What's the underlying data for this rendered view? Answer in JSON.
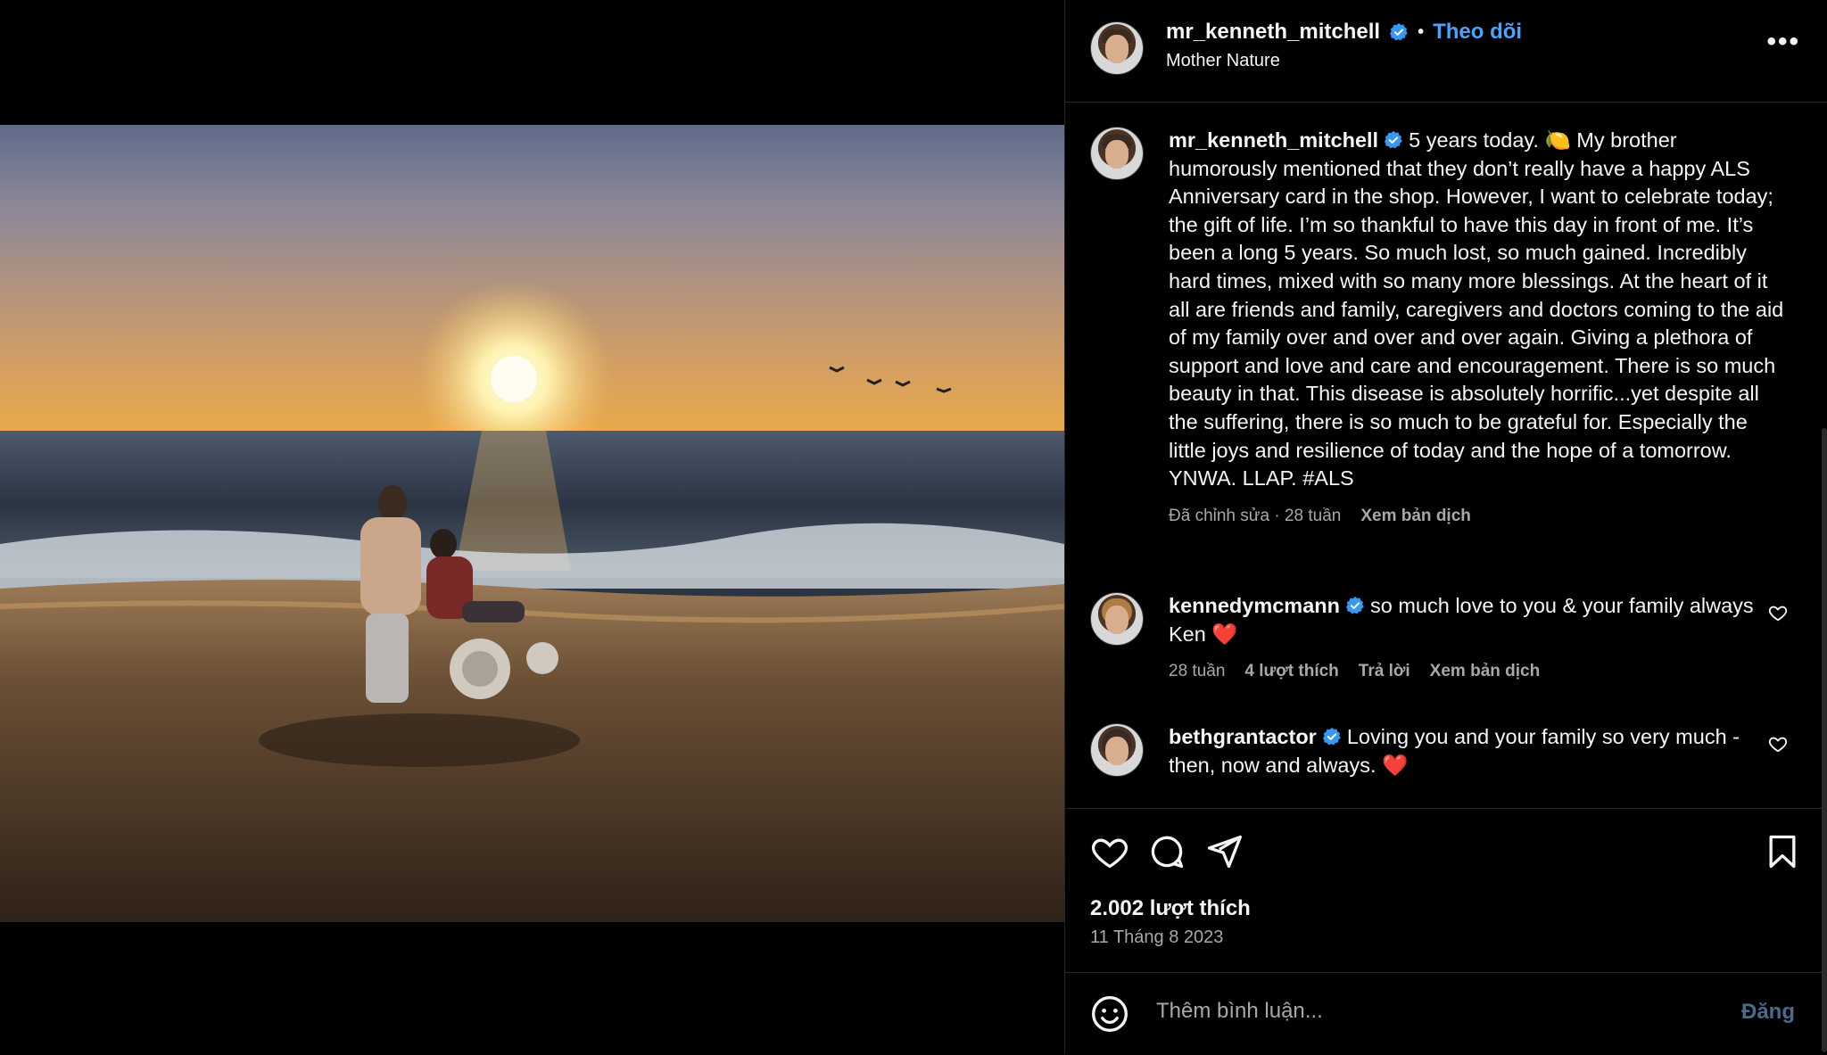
{
  "post": {
    "username": "mr_kenneth_mitchell",
    "follow_label": "Theo dõi",
    "location": "Mother Nature",
    "more_label": "•••",
    "caption": {
      "username": "mr_kenneth_mitchell",
      "text": "5 years today. 🍋 My brother humorously mentioned that they don’t really have a happy ALS Anniversary card in the shop. However, I want to celebrate today; the gift of life. I’m so thankful to have this day in front of me. It’s been a long 5 years. So much lost, so much gained. Incredibly hard times, mixed with so many more blessings. At the heart of it all are friends and family, caregivers and doctors coming to the aid of my family over and over and over again. Giving a plethora of support and love and care and encouragement. There is so much beauty in that. This disease is absolutely horrific...yet despite all the suffering, there is so much to be grateful for. Especially the little joys and resilience of today and the hope of a tomorrow. YNWA. LLAP. #ALS",
      "meta": "Đã chỉnh sửa · 28 tuần",
      "translate": "Xem bản dịch"
    },
    "comments": [
      {
        "username": "kennedymcmann",
        "text": "so much love to you & your family always Ken ❤️",
        "age": "28 tuần",
        "likes": "4 lượt thích",
        "reply": "Trả lời",
        "translate": "Xem bản dịch"
      },
      {
        "username": "bethgrantactor",
        "text": "Loving you and your family so very much - then, now and always. ❤️"
      }
    ],
    "likes_count": "2.002 lượt thích",
    "date": "11 Tháng 8 2023",
    "comment_placeholder": "Thêm bình luận...",
    "post_button": "Đăng"
  },
  "colors": {
    "accent": "#4aa3ff",
    "verified": "#3897f0",
    "muted": "#a8a8a8",
    "heart": "#ed4956"
  }
}
